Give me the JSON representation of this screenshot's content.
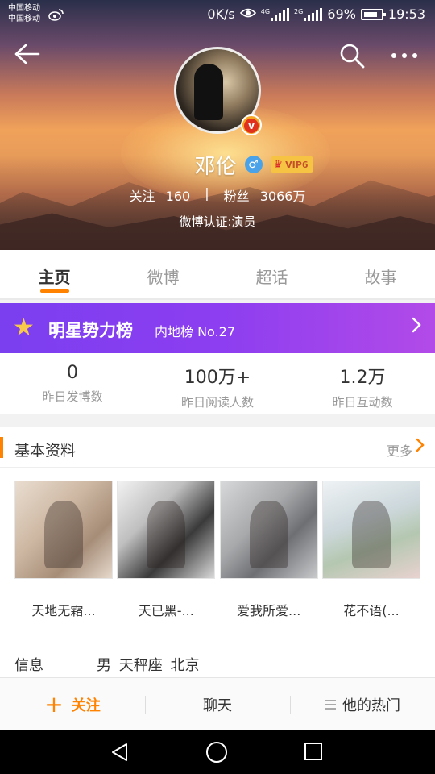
{
  "status_bar": {
    "carrier_1": "中国移动",
    "carrier_2": "中国移动",
    "speed": "0K/s",
    "net_1": "4G",
    "net_2": "2G",
    "battery": "69%",
    "time": "19:53"
  },
  "profile": {
    "name": "邓伦",
    "gender_symbol": "♂",
    "vip_label": "VIP6",
    "following_label": "关注",
    "following_count": "160",
    "separator": "|",
    "fans_label": "粉丝",
    "fans_count": "3066万",
    "verification": "微博认证:演员",
    "v_badge": "v"
  },
  "tabs": [
    {
      "label": "主页",
      "active": true
    },
    {
      "label": "微博",
      "active": false
    },
    {
      "label": "超话",
      "active": false
    },
    {
      "label": "故事",
      "active": false
    }
  ],
  "star_banner": {
    "title": "明星势力榜",
    "rank": "内地榜 No.27"
  },
  "metrics": [
    {
      "value": "0",
      "label": "昨日发博数"
    },
    {
      "value": "100万+",
      "label": "昨日阅读人数"
    },
    {
      "value": "1.2万",
      "label": "昨日互动数"
    }
  ],
  "basic_info": {
    "title": "基本资料",
    "more": "更多",
    "works": [
      {
        "title": "天地无霜..."
      },
      {
        "title": "天已黑-..."
      },
      {
        "title": "爱我所爱..."
      },
      {
        "title": "花不语(..."
      }
    ],
    "info_label": "信息",
    "info_value": "男  天秤座  北京"
  },
  "action_bar": {
    "follow": "关注",
    "chat": "聊天",
    "hot": "他的热门"
  },
  "colors": {
    "accent": "#ff8200",
    "banner_start": "#7b3ff0",
    "banner_end": "#b24ae8"
  }
}
